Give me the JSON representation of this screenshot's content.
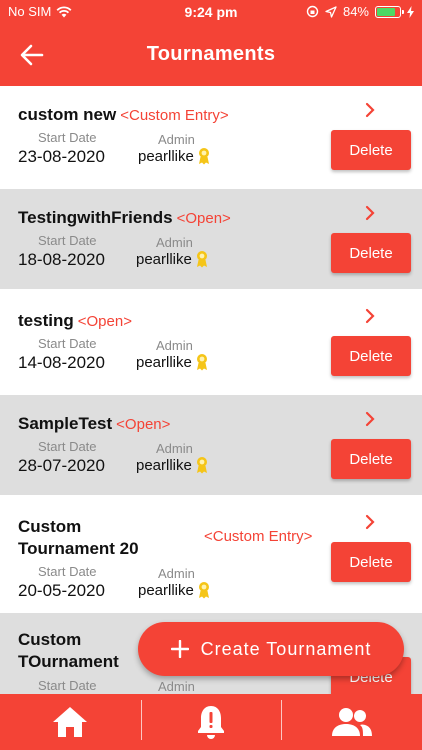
{
  "status": {
    "carrier": "No SIM",
    "time": "9:24 pm",
    "battery": "84%",
    "battery_level": 0.84
  },
  "appbar": {
    "title": "Tournaments"
  },
  "labels": {
    "start_date": "Start Date",
    "admin": "Admin",
    "delete": "Delete"
  },
  "tournaments": [
    {
      "name": "custom new",
      "tag": "<Custom Entry>",
      "start_date": "23-08-2020",
      "admin": "pearllike"
    },
    {
      "name": "TestingwithFriends",
      "tag": "<Open>",
      "start_date": "18-08-2020",
      "admin": "pearllike"
    },
    {
      "name": "testing",
      "tag": "<Open>",
      "start_date": "14-08-2020",
      "admin": "pearllike"
    },
    {
      "name": "SampleTest",
      "tag": "<Open>",
      "start_date": "28-07-2020",
      "admin": "pearllike"
    },
    {
      "name_line1": "Custom",
      "name_line2": "Tournament 20",
      "tag": "<Custom Entry>",
      "start_date": "20-05-2020",
      "admin": "pearllike"
    },
    {
      "name_line1": "Custom",
      "name_line2": "TOurnament"
    }
  ],
  "fab": {
    "label": "Create Tournament"
  },
  "colors": {
    "primary": "#f44336",
    "shaded_row": "#dedede",
    "badge": "#f5c518"
  }
}
